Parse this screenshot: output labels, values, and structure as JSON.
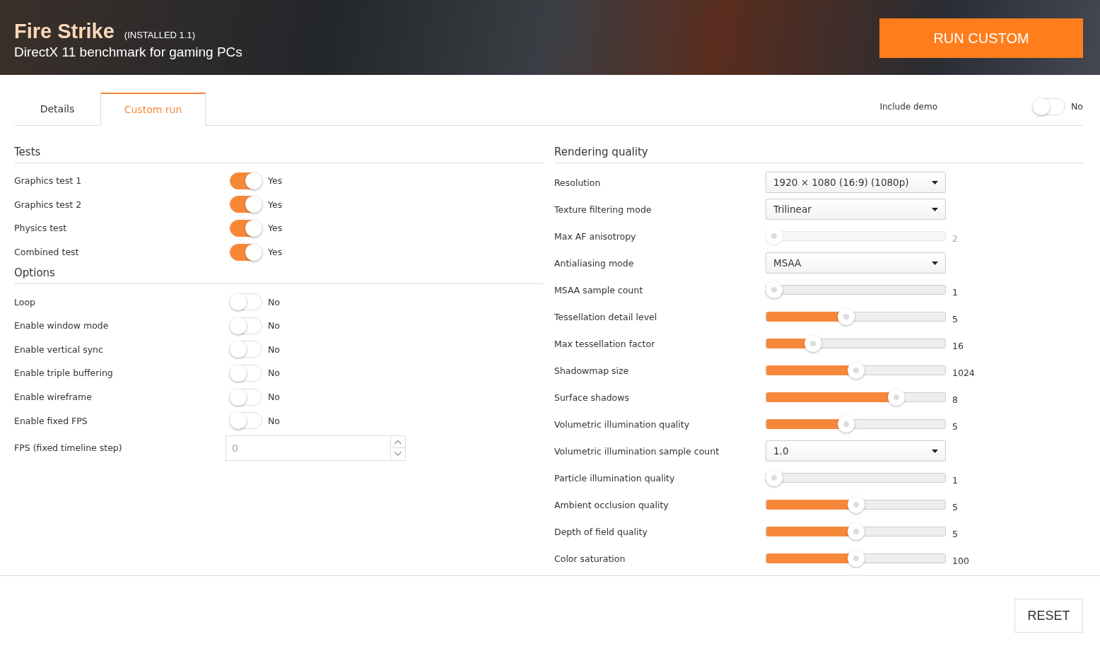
{
  "header": {
    "title": "Fire Strike",
    "version": "(INSTALLED 1.1)",
    "subtitle": "DirectX 11 benchmark for gaming PCs",
    "run_button": "RUN CUSTOM"
  },
  "tabs": [
    {
      "label": "Details",
      "selected": false
    },
    {
      "label": "Custom run",
      "selected": true
    }
  ],
  "include_demo": {
    "label": "Include demo",
    "on": false,
    "state_text": "No"
  },
  "tests": {
    "title": "Tests",
    "items": [
      {
        "label": "Graphics test 1",
        "on": true,
        "state_text": "Yes"
      },
      {
        "label": "Graphics test 2",
        "on": true,
        "state_text": "Yes"
      },
      {
        "label": "Physics test",
        "on": true,
        "state_text": "Yes"
      },
      {
        "label": "Combined test",
        "on": true,
        "state_text": "Yes"
      }
    ]
  },
  "options": {
    "title": "Options",
    "items": [
      {
        "label": "Loop",
        "on": false,
        "state_text": "No"
      },
      {
        "label": "Enable window mode",
        "on": false,
        "state_text": "No"
      },
      {
        "label": "Enable vertical sync",
        "on": false,
        "state_text": "No"
      },
      {
        "label": "Enable triple buffering",
        "on": false,
        "state_text": "No"
      },
      {
        "label": "Enable wireframe",
        "on": false,
        "state_text": "No"
      },
      {
        "label": "Enable fixed FPS",
        "on": false,
        "state_text": "No"
      }
    ],
    "fps": {
      "label": "FPS (fixed timeline step)",
      "value": "0",
      "disabled": true
    }
  },
  "rendering": {
    "title": "Rendering quality",
    "items": [
      {
        "kind": "select",
        "label": "Resolution",
        "value": "1920 × 1080 (16:9) (1080p)"
      },
      {
        "kind": "select",
        "label": "Texture filtering mode",
        "value": "Trilinear"
      },
      {
        "kind": "slider",
        "label": "Max AF anisotropy",
        "level": 0,
        "reading": "2",
        "disabled": true
      },
      {
        "kind": "select",
        "label": "Antialiasing mode",
        "value": "MSAA"
      },
      {
        "kind": "slider",
        "label": "MSAA sample count",
        "level": 0,
        "reading": "1",
        "disabled": false
      },
      {
        "kind": "slider",
        "label": "Tessellation detail level",
        "level": 0.44,
        "reading": "5",
        "disabled": false
      },
      {
        "kind": "slider",
        "label": "Max tessellation factor",
        "level": 0.24,
        "reading": "16",
        "disabled": false
      },
      {
        "kind": "slider",
        "label": "Shadowmap size",
        "level": 0.5,
        "reading": "1024",
        "disabled": false
      },
      {
        "kind": "slider",
        "label": "Surface shadows",
        "level": 0.75,
        "reading": "8",
        "disabled": false
      },
      {
        "kind": "slider",
        "label": "Volumetric illumination quality",
        "level": 0.44,
        "reading": "5",
        "disabled": false
      },
      {
        "kind": "select",
        "label": "Volumetric illumination sample count",
        "value": "1.0"
      },
      {
        "kind": "slider",
        "label": "Particle illumination quality",
        "level": 0,
        "reading": "1",
        "disabled": false
      },
      {
        "kind": "slider",
        "label": "Ambient occlusion quality",
        "level": 0.5,
        "reading": "5",
        "disabled": false
      },
      {
        "kind": "slider",
        "label": "Depth of field quality",
        "level": 0.5,
        "reading": "5",
        "disabled": false
      },
      {
        "kind": "slider",
        "label": "Color saturation",
        "level": 0.5,
        "reading": "100",
        "disabled": false
      }
    ]
  },
  "reset_button": "RESET"
}
